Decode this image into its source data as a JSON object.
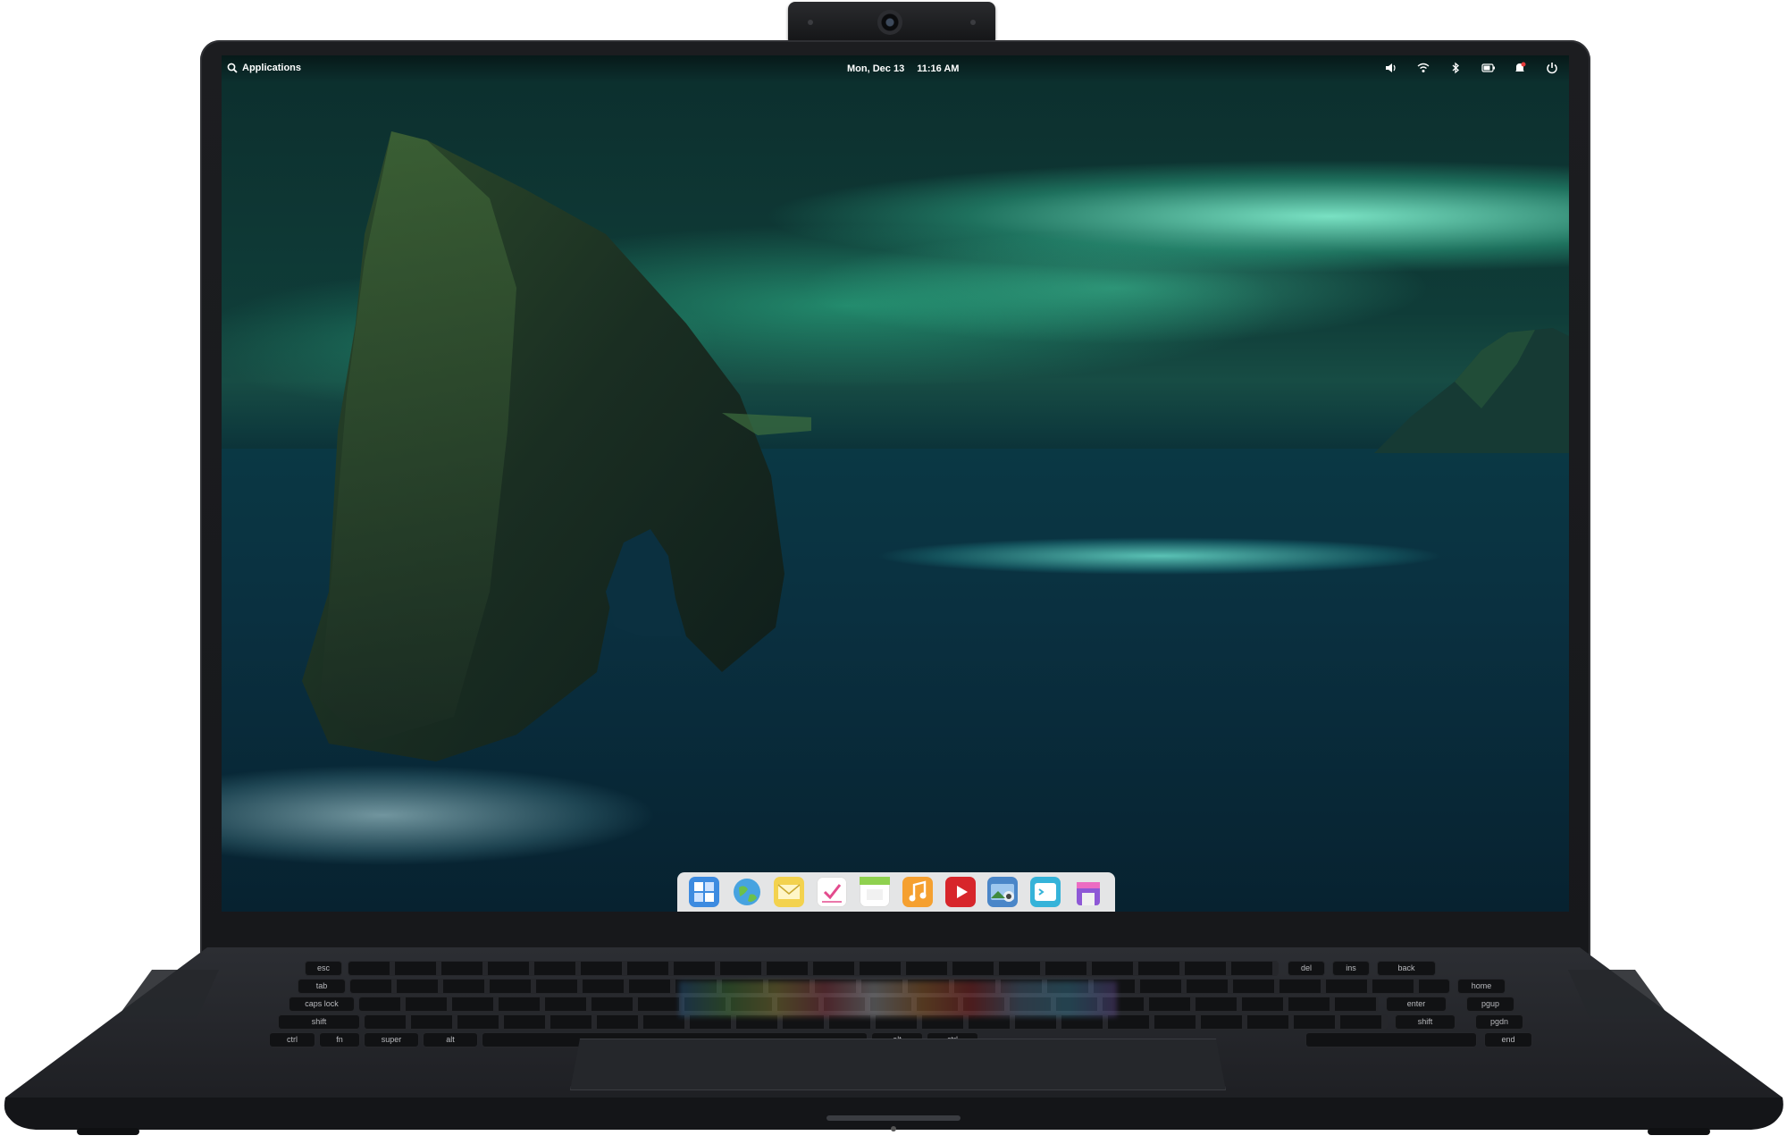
{
  "panel": {
    "applications_label": "Applications",
    "date": "Mon, Dec 13",
    "time": "11:16 AM",
    "tray_icons": [
      "volume-icon",
      "wifi-icon",
      "bluetooth-icon",
      "battery-icon",
      "notifications-icon",
      "power-icon"
    ]
  },
  "dock": {
    "items": [
      {
        "name": "multitasking-view-icon",
        "color": "#3d8be0"
      },
      {
        "name": "web-browser-icon",
        "color": "#47a3e0"
      },
      {
        "name": "mail-icon",
        "color": "#f3d24e"
      },
      {
        "name": "tasks-icon",
        "color": "#e34b8d"
      },
      {
        "name": "calendar-icon",
        "color": "#8fd14f"
      },
      {
        "name": "music-icon",
        "color": "#f5a030"
      },
      {
        "name": "videos-icon",
        "color": "#d7262b"
      },
      {
        "name": "photos-icon",
        "color": "#4a86c8"
      },
      {
        "name": "terminal-icon",
        "color": "#35b3d9"
      },
      {
        "name": "appcenter-icon",
        "color": "#8e58d6"
      }
    ]
  },
  "keyboard": {
    "keys": [
      "esc",
      "tab",
      "caps lock",
      "shift",
      "ctrl",
      "fn",
      "super",
      "alt",
      "alt",
      "ctrl",
      "back",
      "enter",
      "shift",
      "del",
      "ins",
      "pgup",
      "pgdn",
      "home",
      "end"
    ]
  },
  "colors": {
    "aurora": "#7ff5d3",
    "sea": "#0a3040",
    "bezel": "#17181b"
  }
}
